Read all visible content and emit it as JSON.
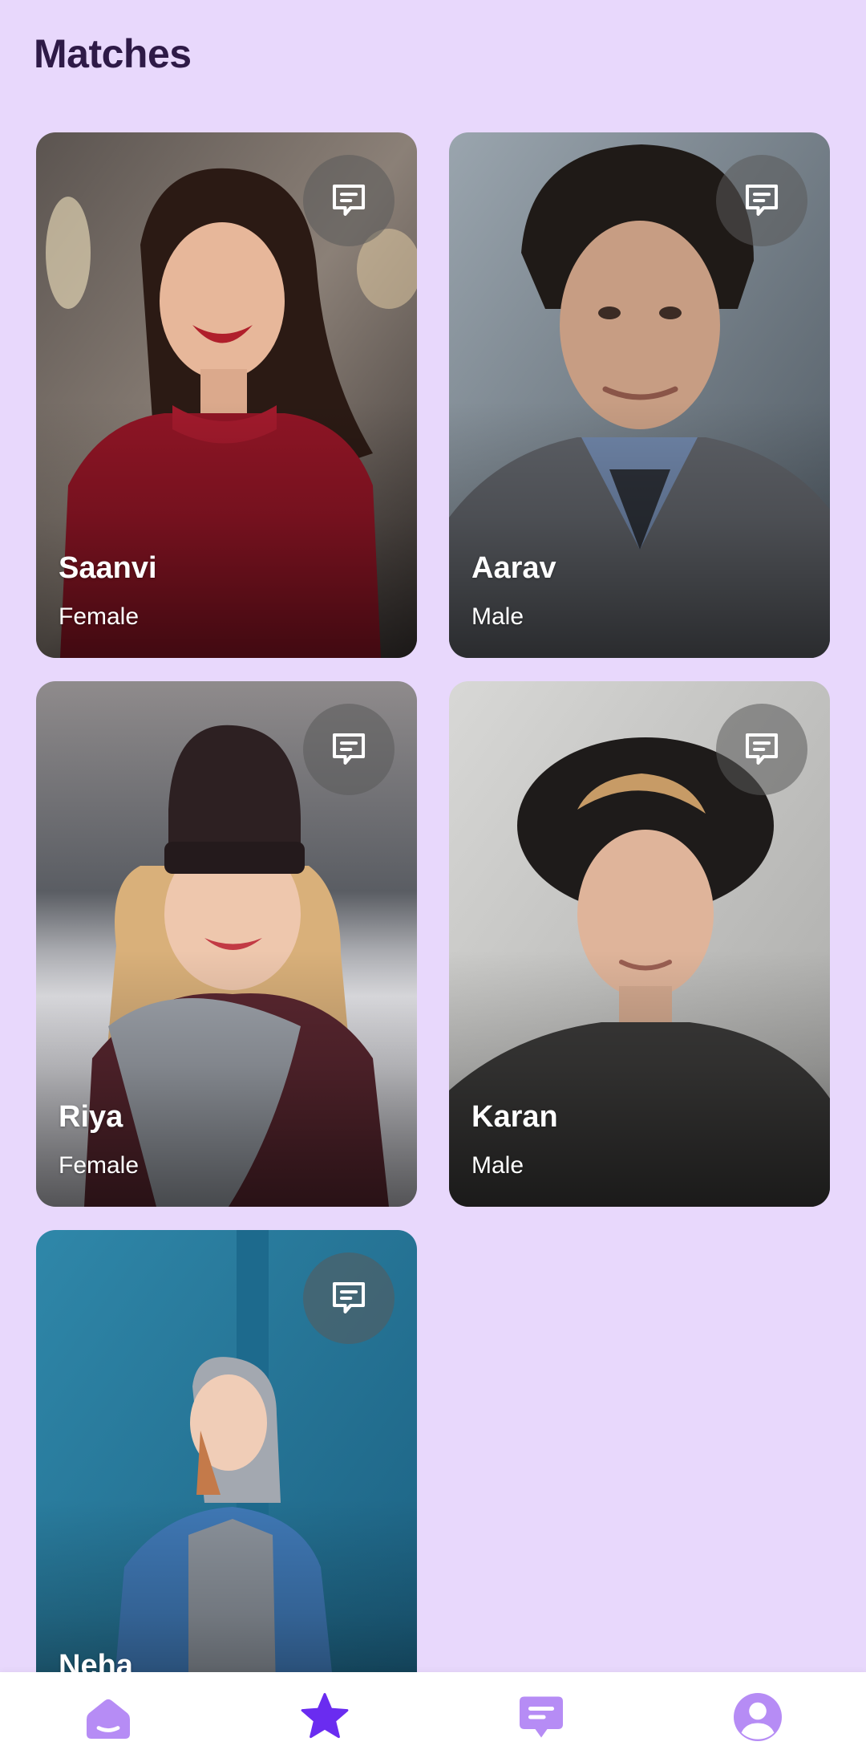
{
  "header": {
    "title": "Matches"
  },
  "matches": [
    {
      "name": "Saanvi",
      "gender": "Female"
    },
    {
      "name": "Aarav",
      "gender": "Male"
    },
    {
      "name": "Riya",
      "gender": "Female"
    },
    {
      "name": "Karan",
      "gender": "Male"
    },
    {
      "name": "Neha",
      "gender": ""
    }
  ],
  "bottom_nav": {
    "items": [
      {
        "icon": "home-icon",
        "active": false
      },
      {
        "icon": "star-icon",
        "active": true
      },
      {
        "icon": "chat-icon",
        "active": false
      },
      {
        "icon": "profile-icon",
        "active": false
      }
    ]
  },
  "colors": {
    "background": "#e8d8fc",
    "title": "#2e1a47",
    "nav_active": "#6a2cf0",
    "nav_inactive": "#b68cf5"
  }
}
